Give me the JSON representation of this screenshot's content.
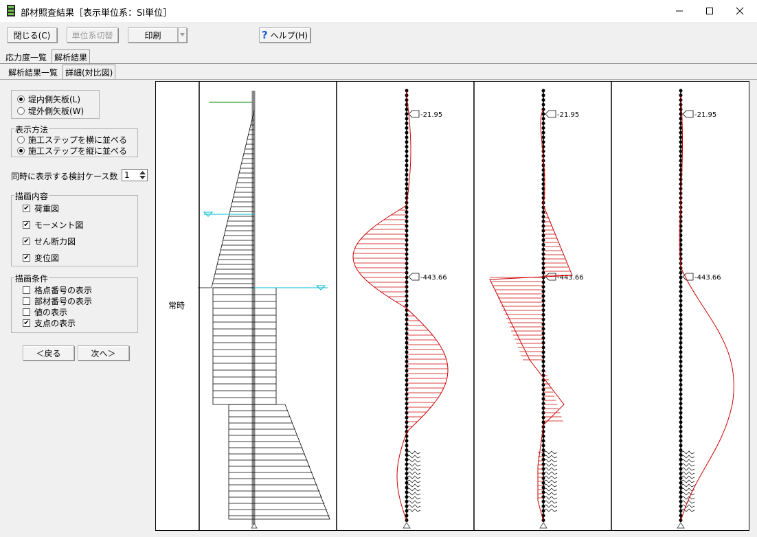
{
  "window": {
    "title": "部材照査結果［表示単位系：SI単位］"
  },
  "toolbar": {
    "close_label": "閉じる(C)",
    "unit_label": "単位系切替",
    "print_label": "印刷",
    "help_label": "ヘルプ(H)"
  },
  "tabs": {
    "top": [
      "応力度一覧",
      "解析結果"
    ],
    "sub": [
      "解析結果一覧",
      "詳細(対比図)"
    ]
  },
  "side_options": {
    "inner": "堤内側矢板(L)",
    "outer": "堤外側矢板(W)",
    "selected": "inner"
  },
  "display_method": {
    "legend": "表示方法",
    "options": [
      "施工ステップを横に並べる",
      "施工ステップを縦に並べる"
    ],
    "selected": 1
  },
  "case_count": {
    "label": "同時に表示する検討ケース数",
    "value": "1"
  },
  "draw_content": {
    "legend": "描画内容",
    "items": [
      {
        "label": "荷重図",
        "checked": true
      },
      {
        "label": "モーメント図",
        "checked": true
      },
      {
        "label": "せん断力図",
        "checked": true
      },
      {
        "label": "変位図",
        "checked": true
      }
    ]
  },
  "draw_conditions": {
    "legend": "描画条件",
    "items": [
      {
        "label": "格点番号の表示",
        "checked": false
      },
      {
        "label": "部材番号の表示",
        "checked": false
      },
      {
        "label": "値の表示",
        "checked": false
      },
      {
        "label": "支点の表示",
        "checked": true
      }
    ]
  },
  "nav": {
    "prev": "＜戻る",
    "next": "次へ＞"
  },
  "plot": {
    "case_label": "常時",
    "level1": "-21.95",
    "level2": "-443.66"
  },
  "colors": {
    "curve": "#cc0000",
    "water": "#00bcd4",
    "ground": "#008000"
  }
}
